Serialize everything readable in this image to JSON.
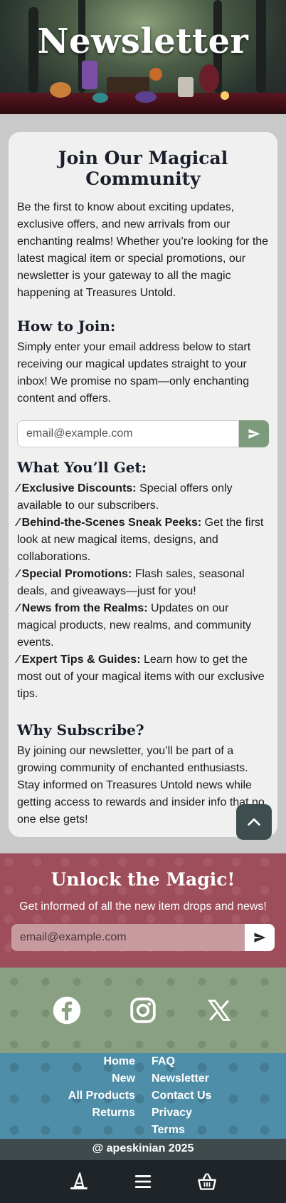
{
  "hero": {
    "title": "Newsletter"
  },
  "card": {
    "title": "Join Our Magical Community",
    "intro": "Be the first to know about exciting updates, exclusive offers, and new arrivals from our enchanting realms! Whether you’re looking for the latest magical item or special promotions, our newsletter is your gateway to all the magic happening at Treasures Untold.",
    "how_heading": "How to Join:",
    "how_text": "Simply enter your email address below to start receiving our magical updates straight to your inbox! We promise no spam—only enchanting content and offers.",
    "email_placeholder": "email@example.com",
    "benefits_heading": "What You’ll Get:",
    "benefits": [
      {
        "title": "Exclusive Discounts:",
        "text": " Special offers only available to our subscribers."
      },
      {
        "title": "Behind-the-Scenes Sneak Peeks:",
        "text": " Get the first look at new magical items, designs, and collaborations."
      },
      {
        "title": "Special Promotions:",
        "text": " Flash sales, seasonal deals, and giveaways—just for you!"
      },
      {
        "title": "News from the Realms:",
        "text": " Updates on our magical products, new realms, and community events."
      },
      {
        "title": "Expert Tips & Guides:",
        "text": " Learn how to get the most out of your magical items with our exclusive tips."
      }
    ],
    "why_heading": "Why Subscribe?",
    "why_text": "By joining our newsletter, you’ll be part of a growing community of enchanted enthusiasts. Stay informed on Treasures Untold news while getting access to rewards and insider info that no one else gets!"
  },
  "unlock": {
    "title": "Unlock the Magic!",
    "subtitle": "Get informed of all the new item drops and news!",
    "email_placeholder": "email@example.com"
  },
  "social": {
    "icons": [
      "facebook-icon",
      "instagram-icon",
      "x-icon"
    ]
  },
  "footer_links": {
    "left": [
      "Home",
      "New",
      "All Products",
      "Returns"
    ],
    "right": [
      "FAQ",
      "Newsletter",
      "Contact Us",
      "Privacy",
      "Terms"
    ]
  },
  "copyright": "@ apeskinian 2025",
  "colors": {
    "card_bg": "#f0f0f0",
    "send_button": "#7c9a7c",
    "unlock_bg": "#9e4d5a",
    "social_bg": "#8aa082",
    "links_bg": "#4f8ea8",
    "bottom_nav_bg": "#1e2428"
  }
}
